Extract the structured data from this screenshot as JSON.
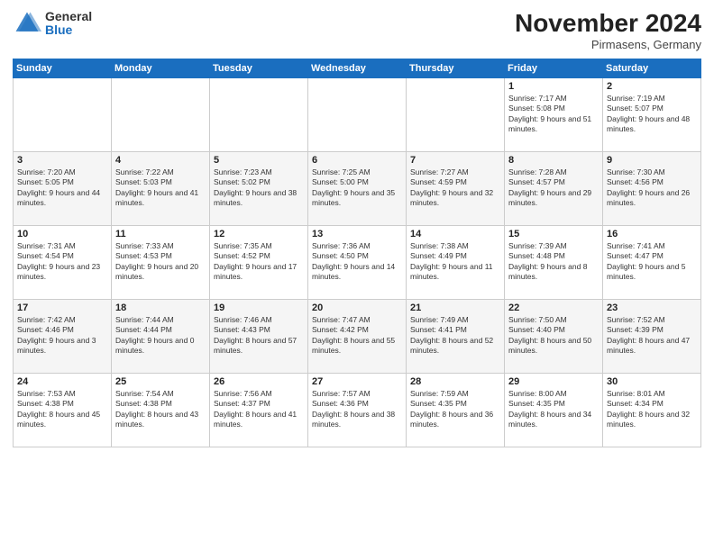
{
  "logo": {
    "general": "General",
    "blue": "Blue"
  },
  "title": "November 2024",
  "subtitle": "Pirmasens, Germany",
  "days_of_week": [
    "Sunday",
    "Monday",
    "Tuesday",
    "Wednesday",
    "Thursday",
    "Friday",
    "Saturday"
  ],
  "weeks": [
    [
      {
        "day": "",
        "info": ""
      },
      {
        "day": "",
        "info": ""
      },
      {
        "day": "",
        "info": ""
      },
      {
        "day": "",
        "info": ""
      },
      {
        "day": "",
        "info": ""
      },
      {
        "day": "1",
        "info": "Sunrise: 7:17 AM\nSunset: 5:08 PM\nDaylight: 9 hours and 51 minutes."
      },
      {
        "day": "2",
        "info": "Sunrise: 7:19 AM\nSunset: 5:07 PM\nDaylight: 9 hours and 48 minutes."
      }
    ],
    [
      {
        "day": "3",
        "info": "Sunrise: 7:20 AM\nSunset: 5:05 PM\nDaylight: 9 hours and 44 minutes."
      },
      {
        "day": "4",
        "info": "Sunrise: 7:22 AM\nSunset: 5:03 PM\nDaylight: 9 hours and 41 minutes."
      },
      {
        "day": "5",
        "info": "Sunrise: 7:23 AM\nSunset: 5:02 PM\nDaylight: 9 hours and 38 minutes."
      },
      {
        "day": "6",
        "info": "Sunrise: 7:25 AM\nSunset: 5:00 PM\nDaylight: 9 hours and 35 minutes."
      },
      {
        "day": "7",
        "info": "Sunrise: 7:27 AM\nSunset: 4:59 PM\nDaylight: 9 hours and 32 minutes."
      },
      {
        "day": "8",
        "info": "Sunrise: 7:28 AM\nSunset: 4:57 PM\nDaylight: 9 hours and 29 minutes."
      },
      {
        "day": "9",
        "info": "Sunrise: 7:30 AM\nSunset: 4:56 PM\nDaylight: 9 hours and 26 minutes."
      }
    ],
    [
      {
        "day": "10",
        "info": "Sunrise: 7:31 AM\nSunset: 4:54 PM\nDaylight: 9 hours and 23 minutes."
      },
      {
        "day": "11",
        "info": "Sunrise: 7:33 AM\nSunset: 4:53 PM\nDaylight: 9 hours and 20 minutes."
      },
      {
        "day": "12",
        "info": "Sunrise: 7:35 AM\nSunset: 4:52 PM\nDaylight: 9 hours and 17 minutes."
      },
      {
        "day": "13",
        "info": "Sunrise: 7:36 AM\nSunset: 4:50 PM\nDaylight: 9 hours and 14 minutes."
      },
      {
        "day": "14",
        "info": "Sunrise: 7:38 AM\nSunset: 4:49 PM\nDaylight: 9 hours and 11 minutes."
      },
      {
        "day": "15",
        "info": "Sunrise: 7:39 AM\nSunset: 4:48 PM\nDaylight: 9 hours and 8 minutes."
      },
      {
        "day": "16",
        "info": "Sunrise: 7:41 AM\nSunset: 4:47 PM\nDaylight: 9 hours and 5 minutes."
      }
    ],
    [
      {
        "day": "17",
        "info": "Sunrise: 7:42 AM\nSunset: 4:46 PM\nDaylight: 9 hours and 3 minutes."
      },
      {
        "day": "18",
        "info": "Sunrise: 7:44 AM\nSunset: 4:44 PM\nDaylight: 9 hours and 0 minutes."
      },
      {
        "day": "19",
        "info": "Sunrise: 7:46 AM\nSunset: 4:43 PM\nDaylight: 8 hours and 57 minutes."
      },
      {
        "day": "20",
        "info": "Sunrise: 7:47 AM\nSunset: 4:42 PM\nDaylight: 8 hours and 55 minutes."
      },
      {
        "day": "21",
        "info": "Sunrise: 7:49 AM\nSunset: 4:41 PM\nDaylight: 8 hours and 52 minutes."
      },
      {
        "day": "22",
        "info": "Sunrise: 7:50 AM\nSunset: 4:40 PM\nDaylight: 8 hours and 50 minutes."
      },
      {
        "day": "23",
        "info": "Sunrise: 7:52 AM\nSunset: 4:39 PM\nDaylight: 8 hours and 47 minutes."
      }
    ],
    [
      {
        "day": "24",
        "info": "Sunrise: 7:53 AM\nSunset: 4:38 PM\nDaylight: 8 hours and 45 minutes."
      },
      {
        "day": "25",
        "info": "Sunrise: 7:54 AM\nSunset: 4:38 PM\nDaylight: 8 hours and 43 minutes."
      },
      {
        "day": "26",
        "info": "Sunrise: 7:56 AM\nSunset: 4:37 PM\nDaylight: 8 hours and 41 minutes."
      },
      {
        "day": "27",
        "info": "Sunrise: 7:57 AM\nSunset: 4:36 PM\nDaylight: 8 hours and 38 minutes."
      },
      {
        "day": "28",
        "info": "Sunrise: 7:59 AM\nSunset: 4:35 PM\nDaylight: 8 hours and 36 minutes."
      },
      {
        "day": "29",
        "info": "Sunrise: 8:00 AM\nSunset: 4:35 PM\nDaylight: 8 hours and 34 minutes."
      },
      {
        "day": "30",
        "info": "Sunrise: 8:01 AM\nSunset: 4:34 PM\nDaylight: 8 hours and 32 minutes."
      }
    ]
  ]
}
